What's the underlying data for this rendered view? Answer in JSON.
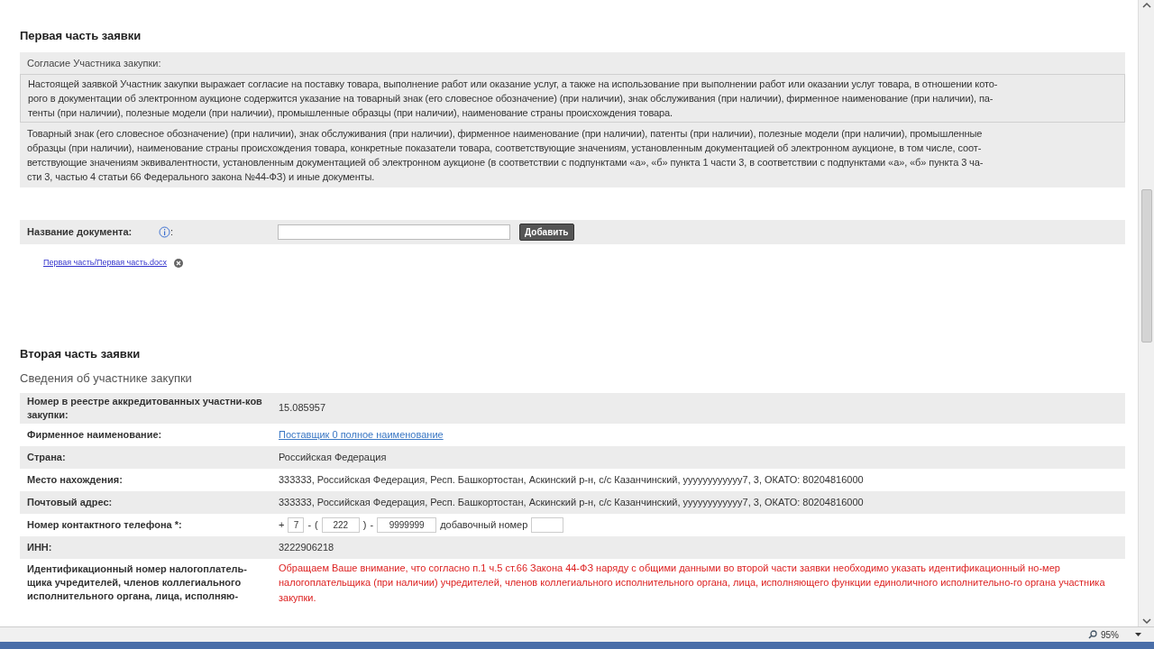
{
  "part1": {
    "title": "Первая часть заявки",
    "consent_label": "Согласие Участника закупки:",
    "consent_lines": [
      "Настоящей заявкой Участник закупки выражает согласие на поставку товара, выполнение работ или оказание услуг, а также на использование при выполнении работ или оказании услуг товара, в отношении кото-",
      "рого в документации об электронном аукционе содержится указание на товарный знак (его словесное обозначение) (при наличии), знак обслуживания (при наличии), фирменное наименование (при наличии), па-",
      "тенты (при наличии), полезные модели (при наличии), промышленные образцы (при наличии), наименование страны происхождения товара."
    ],
    "note_lines": [
      "Товарный знак (его словесное обозначение) (при наличии), знак обслуживания (при наличии), фирменное наименование (при наличии), патенты (при наличии), полезные модели (при наличии), промышленные",
      "образцы (при наличии), наименование страны происхождения товара, конкретные показатели товара, соответствующие значениям, установленным документацией об электронном аукционе, в том числе, соот-",
      "ветствующие значениям эквивалентности, установленным документацией об электронном аукционе (в соответствии с подпунктами «а», «б» пункта 1 части 3, в соответствии с подпунктами «а», «б» пункта 3 ча-",
      "сти 3, частью 4 статьи 66 Федерального закона №44-ФЗ) и иные документы."
    ],
    "doc_label": "Название документа:",
    "doc_colon": ":",
    "add_button": "Добавить",
    "attachment": "Первая часть/Первая часть.docx"
  },
  "part2": {
    "title": "Вторая часть заявки",
    "subtitle": "Сведения об участнике закупки",
    "rows": [
      {
        "kind": "text",
        "label": "Номер в реестре аккредитованных участни-ков закупки:",
        "value": "15.085957"
      },
      {
        "kind": "link",
        "label": "Фирменное наименование:",
        "value": "Поставщик 0 полное наименование"
      },
      {
        "kind": "text",
        "label": "Страна:",
        "value": "Российская Федерация"
      },
      {
        "kind": "text",
        "label": "Место нахождения:",
        "value": "333333, Российская Федерация, Респ. Башкортостан, Аскинский р-н, с/с Казанчинский, yyyyyyyyyyyy7, 3, ОКАТО: 80204816000"
      },
      {
        "kind": "text",
        "label": "Почтовый адрес:",
        "value": "333333, Российская Федерация, Респ. Башкортостан, Аскинский р-н, с/с Казанчинский, yyyyyyyyyyyy7, 3, ОКАТО: 80204816000"
      },
      {
        "kind": "phone",
        "label": "Номер контактного телефона *:",
        "phone": {
          "plus": "+",
          "country": "7",
          "sep1": "-",
          "open": "(",
          "code": "222",
          "close": ")",
          "sep2": "-",
          "number": "9999999",
          "ext_label": "добавочный номер"
        }
      },
      {
        "kind": "text",
        "label": "ИНН:",
        "value": "3222906218"
      },
      {
        "kind": "warning",
        "label": "Идентификационный номер налогоплатель-щика учредителей, членов коллегиального исполнительного органа, лица, исполняю-",
        "value": "Обращаем Ваше внимание, что согласно п.1 ч.5 ст.66 Закона 44-ФЗ наряду с общими данными во второй части заявки необходимо указать идентификационный но-мер налогоплательщика (при наличии) учредителей, членов коллегиального исполнительного органа, лица, исполняющего функции единоличного исполнительно-го органа участника закупки."
      }
    ]
  },
  "status_bar": {
    "zoom": "95%"
  }
}
